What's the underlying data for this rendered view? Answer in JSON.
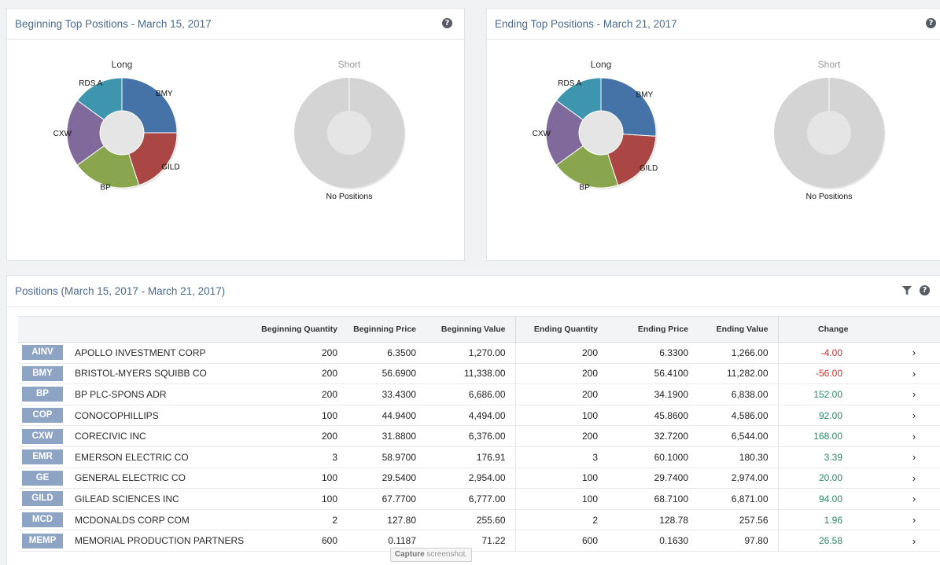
{
  "panels": {
    "beginning": {
      "title": "Beginning Top Positions - March 15, 2017",
      "long_label": "Long",
      "short_label": "Short",
      "no_positions": "No Positions"
    },
    "ending": {
      "title": "Ending Top Positions - March 21, 2017",
      "long_label": "Long",
      "short_label": "Short",
      "no_positions": "No Positions"
    },
    "positions": {
      "title": "Positions (March 15, 2017 - March 21, 2017)"
    }
  },
  "help_icon": "?",
  "table": {
    "columns": [
      "",
      "",
      "Beginning Quantity",
      "Beginning Price",
      "Beginning Value",
      "Ending Quantity",
      "Ending Price",
      "Ending Value",
      "Change",
      ""
    ],
    "rows": [
      {
        "symbol": "AINV",
        "name": "APOLLO INVESTMENT CORP",
        "bq": "200",
        "bp": "6.3500",
        "bv": "1,270.00",
        "eq": "200",
        "ep": "6.3300",
        "ev": "1,266.00",
        "change": "-4.00",
        "dir": "neg"
      },
      {
        "symbol": "BMY",
        "name": "BRISTOL-MYERS SQUIBB CO",
        "bq": "200",
        "bp": "56.6900",
        "bv": "11,338.00",
        "eq": "200",
        "ep": "56.4100",
        "ev": "11,282.00",
        "change": "-56.00",
        "dir": "neg"
      },
      {
        "symbol": "BP",
        "name": "BP PLC-SPONS ADR",
        "bq": "200",
        "bp": "33.4300",
        "bv": "6,686.00",
        "eq": "200",
        "ep": "34.1900",
        "ev": "6,838.00",
        "change": "152.00",
        "dir": "pos"
      },
      {
        "symbol": "COP",
        "name": "CONOCOPHILLIPS",
        "bq": "100",
        "bp": "44.9400",
        "bv": "4,494.00",
        "eq": "100",
        "ep": "45.8600",
        "ev": "4,586.00",
        "change": "92.00",
        "dir": "pos"
      },
      {
        "symbol": "CXW",
        "name": "CORECIVIC INC",
        "bq": "200",
        "bp": "31.8800",
        "bv": "6,376.00",
        "eq": "200",
        "ep": "32.7200",
        "ev": "6,544.00",
        "change": "168.00",
        "dir": "pos"
      },
      {
        "symbol": "EMR",
        "name": "EMERSON ELECTRIC CO",
        "bq": "3",
        "bp": "58.9700",
        "bv": "176.91",
        "eq": "3",
        "ep": "60.1000",
        "ev": "180.30",
        "change": "3.39",
        "dir": "pos"
      },
      {
        "symbol": "GE",
        "name": "GENERAL ELECTRIC CO",
        "bq": "100",
        "bp": "29.5400",
        "bv": "2,954.00",
        "eq": "100",
        "ep": "29.7400",
        "ev": "2,974.00",
        "change": "20.00",
        "dir": "pos"
      },
      {
        "symbol": "GILD",
        "name": "GILEAD SCIENCES INC",
        "bq": "100",
        "bp": "67.7700",
        "bv": "6,777.00",
        "eq": "100",
        "ep": "68.7100",
        "ev": "6,871.00",
        "change": "94.00",
        "dir": "pos"
      },
      {
        "symbol": "MCD",
        "name": "MCDONALDS CORP COM",
        "bq": "2",
        "bp": "127.80",
        "bv": "255.60",
        "eq": "2",
        "ep": "128.78",
        "ev": "257.56",
        "change": "1.96",
        "dir": "pos"
      },
      {
        "symbol": "MEMP",
        "name": "MEMORIAL PRODUCTION PARTNERS",
        "bq": "600",
        "bp": "0.1187",
        "bv": "71.22",
        "eq": "600",
        "ep": "0.1630",
        "ev": "97.80",
        "change": "26.58",
        "dir": "pos"
      }
    ]
  },
  "tooltip": {
    "bold": "Capture",
    "rest": " screenshot."
  },
  "colors": {
    "BMY": "#4572a7",
    "GILD": "#aa4643",
    "BP": "#89a54e",
    "CXW": "#80699b",
    "RDS A": "#3d96ae",
    "no_positions": "#d4d4d4",
    "title": "#4a6a8f",
    "badge": "#8ea4c4",
    "negative": "#cc3333",
    "positive": "#2b8a65"
  },
  "chart_data": [
    {
      "type": "pie",
      "title": "Long",
      "categories": [
        "BMY",
        "GILD",
        "BP",
        "CXW",
        "RDS A"
      ],
      "values": [
        25,
        20,
        20,
        20,
        15
      ]
    },
    {
      "type": "pie",
      "title": "Short",
      "categories": [
        "No Positions"
      ],
      "values": [
        100
      ]
    },
    {
      "type": "pie",
      "title": "Long",
      "categories": [
        "BMY",
        "GILD",
        "BP",
        "CXW",
        "RDS A"
      ],
      "values": [
        26,
        19,
        20,
        20,
        15
      ]
    },
    {
      "type": "pie",
      "title": "Short",
      "categories": [
        "No Positions"
      ],
      "values": [
        100
      ]
    }
  ]
}
